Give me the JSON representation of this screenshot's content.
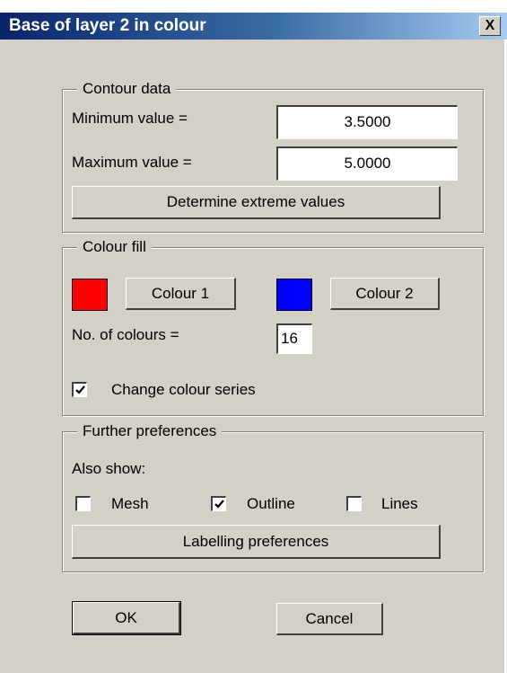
{
  "window": {
    "title": "Base of layer 2 in colour",
    "close_glyph": "X"
  },
  "contour": {
    "group_title": "Contour data",
    "min_label": "Minimum value =",
    "min_value": "3.5000",
    "max_label": "Maximum value =",
    "max_value": "5.0000",
    "determine_button": "Determine extreme values"
  },
  "colour_fill": {
    "group_title": "Colour fill",
    "colour1_swatch": "#ff0000",
    "colour1_button": "Colour 1",
    "colour2_swatch": "#0000ff",
    "colour2_button": "Colour 2",
    "num_colours_label": "No. of colours =",
    "num_colours_value": "16",
    "change_series_label": "Change colour series",
    "change_series_checked": true
  },
  "preferences": {
    "group_title": "Further preferences",
    "also_show_label": "Also show:",
    "mesh_label": "Mesh",
    "mesh_checked": false,
    "outline_label": "Outline",
    "outline_checked": true,
    "lines_label": "Lines",
    "lines_checked": false,
    "labelling_button": "Labelling preferences"
  },
  "footer": {
    "ok_button": "OK",
    "cancel_button": "Cancel"
  }
}
